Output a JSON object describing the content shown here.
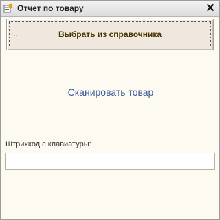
{
  "window": {
    "title": "Отчет по товару",
    "title_icon": "form-document-icon",
    "close_icon": "close-icon"
  },
  "select_button": {
    "dots": "...",
    "label": "Выбрать из справочника"
  },
  "scan_link": {
    "label": "Сканировать товар",
    "color": "#3d5a9e"
  },
  "barcode": {
    "label": "Штрихкод с клавиатуры:",
    "value": "",
    "placeholder": ""
  },
  "colors": {
    "background": "#fdfaf1",
    "button_bg": "#f0e8de",
    "button_text": "#4a3400"
  }
}
